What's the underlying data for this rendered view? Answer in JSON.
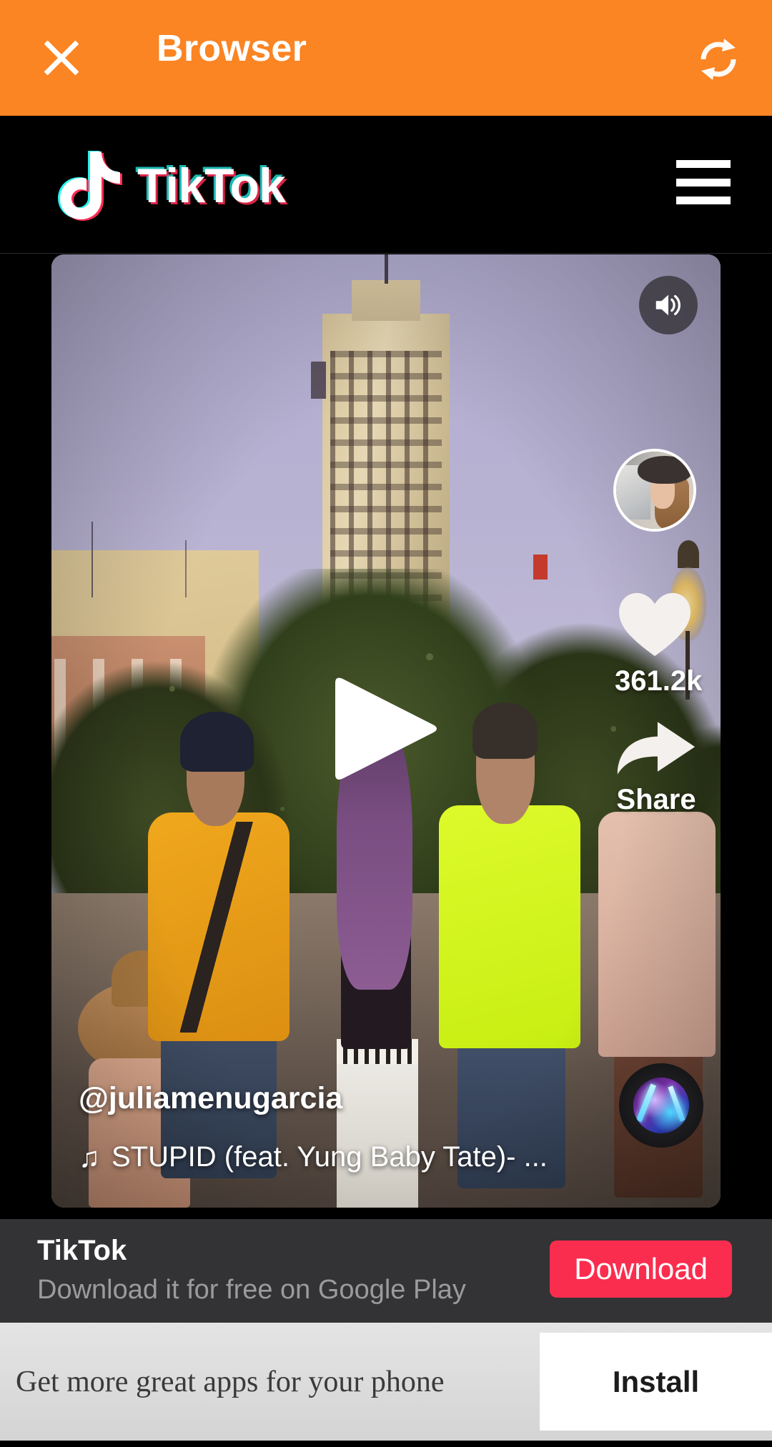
{
  "browser_bar": {
    "title": "Browser",
    "close_icon": "close-icon",
    "refresh_icon": "refresh-icon",
    "background_color": "#fb8423"
  },
  "site_header": {
    "logo_text": "TikTok",
    "logo_icon": "tiktok-note-icon",
    "menu_icon": "hamburger-menu-icon",
    "background_color": "#000000"
  },
  "video": {
    "sound_icon": "speaker-on-icon",
    "play_icon": "play-icon",
    "avatar_icon": "user-avatar",
    "like_icon": "heart-icon",
    "like_count": "361.2k",
    "share_icon": "share-arrow-icon",
    "share_label": "Share",
    "music_disc_icon": "music-disc-icon",
    "username": "@juliamenugarcia",
    "music_note_glyph": "♫",
    "song": "STUPID (feat. Yung Baby Tate)- ..."
  },
  "download_banner": {
    "app_name": "TikTok",
    "subtitle": "Download it for free on Google Play",
    "button_label": "Download",
    "button_color": "#fb2d4e",
    "background_color": "#333335"
  },
  "install_banner": {
    "message": "Get more great apps for your phone",
    "button_label": "Install",
    "background_color": "#e0e0e0"
  }
}
